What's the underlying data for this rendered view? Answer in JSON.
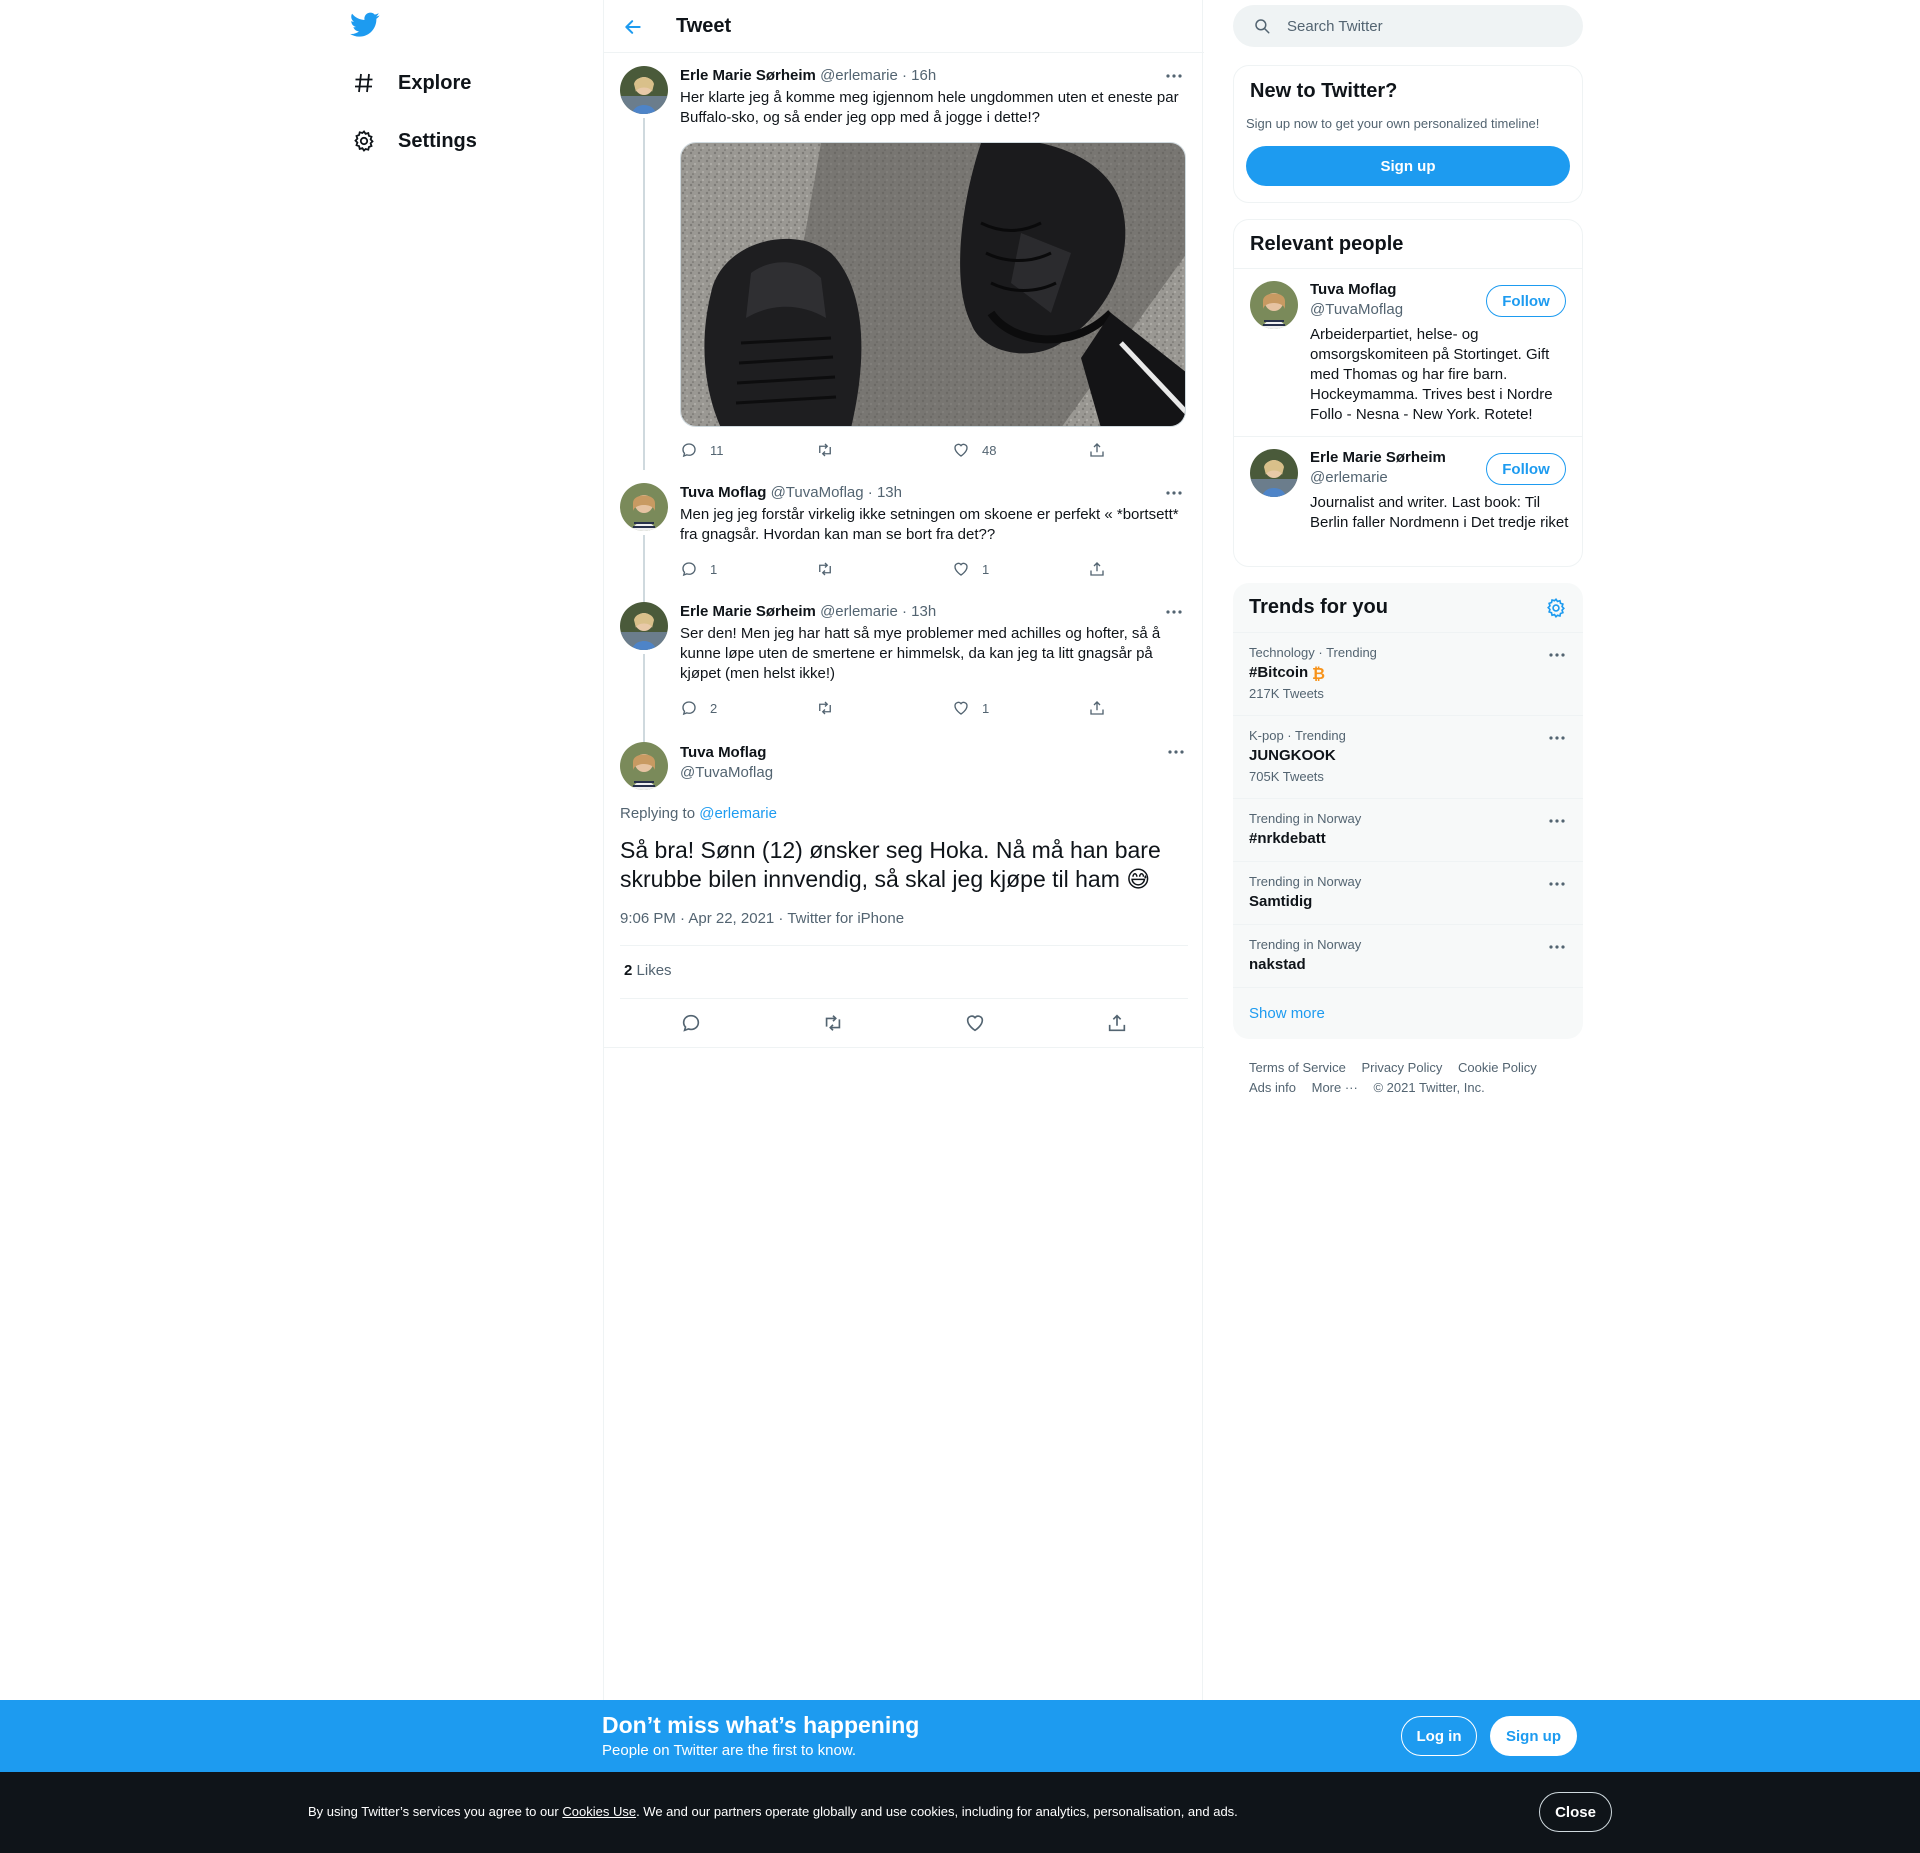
{
  "nav": {
    "logo": "twitter-bird-icon",
    "items": [
      {
        "label": "Explore",
        "icon": "hashtag-icon"
      },
      {
        "label": "Settings",
        "icon": "gear-icon"
      }
    ]
  },
  "header": {
    "title": "Tweet"
  },
  "thread": [
    {
      "name": "Erle Marie Sørheim",
      "handle": "@erlemarie",
      "time": "16h",
      "text": "Her klarte jeg å komme meg igjennom hele ungdommen uten et eneste par Buffalo-sko, og så ender jeg opp med å jogge i dette!?",
      "replies": "11",
      "retweets": "",
      "likes": "48"
    },
    {
      "name": "Tuva Moflag",
      "handle": "@TuvaMoflag",
      "time": "13h",
      "text": "Men jeg jeg forstår virkelig ikke setningen om skoene er perfekt « *bortsett* fra gnagsår. Hvordan kan man se bort fra det??",
      "replies": "1",
      "retweets": "",
      "likes": "1"
    },
    {
      "name": "Erle Marie Sørheim",
      "handle": "@erlemarie",
      "time": "13h",
      "text": "Ser den! Men jeg har hatt så mye problemer med achilles og hofter, så å kunne løpe uten de smertene er himmelsk, da kan jeg ta litt gnagsår på kjøpet (men helst ikke!)",
      "replies": "2",
      "retweets": "",
      "likes": "1"
    }
  ],
  "main_tweet": {
    "name": "Tuva Moflag",
    "handle": "@TuvaMoflag",
    "replying_prefix": "Replying to",
    "replying_to": "@erlemarie",
    "text": "Så bra! Sønn (12) ønsker seg Hoka. Nå må han bare skrubbe bilen innvendig, så skal jeg kjøpe til ham 😅",
    "timestamp": "9:06 PM · Apr 22, 2021 · Twitter for iPhone",
    "likes_count": "2",
    "likes_label": "Likes"
  },
  "sidebar": {
    "search_placeholder": "Search Twitter",
    "new_title": "New to Twitter?",
    "new_sub": "Sign up now to get your own personalized timeline!",
    "signup_label": "Sign up",
    "relevant_title": "Relevant people",
    "people": [
      {
        "name": "Tuva Moflag",
        "handle": "@TuvaMoflag",
        "bio": "Arbeiderpartiet, helse- og omsorgskomiteen på Stortinget. Gift med Thomas og har fire barn. Hockeymamma. Trives best i Nordre Follo - Nesna - New York. Rotete!",
        "follow": "Follow"
      },
      {
        "name": "Erle Marie Sørheim",
        "handle": "@erlemarie",
        "bio": "Journalist and writer. Last book: Til Berlin faller Nordmenn i Det tredje riket",
        "follow": "Follow"
      }
    ],
    "trends_title": "Trends for you",
    "trends": [
      {
        "context": "Technology · Trending",
        "name": "#Bitcoin",
        "count": "217K Tweets"
      },
      {
        "context": "K-pop · Trending",
        "name": "JUNGKOOK",
        "count": "705K Tweets"
      },
      {
        "context": "Trending in Norway",
        "name": "#nrkdebatt",
        "count": ""
      },
      {
        "context": "Trending in Norway",
        "name": "Samtidig",
        "count": ""
      },
      {
        "context": "Trending in Norway",
        "name": "nakstad",
        "count": ""
      }
    ],
    "show_more": "Show more",
    "footer": {
      "terms": "Terms of Service",
      "privacy": "Privacy Policy",
      "cookie": "Cookie Policy",
      "ads": "Ads info",
      "more": "More ···",
      "copyright": "© 2021 Twitter, Inc."
    }
  },
  "bottom_bar": {
    "title": "Don’t miss what’s happening",
    "subtitle": "People on Twitter are the first to know.",
    "login": "Log in",
    "signup": "Sign up"
  },
  "cookie": {
    "text_before": "By using Twitter’s services you agree to our ",
    "link": "Cookies Use",
    "text_after": ". We and our partners operate globally and use cookies, including for analytics, personalisation, and ads.",
    "close": "Close"
  },
  "colors": {
    "accent": "#1d9bf0",
    "text": "#0f1419",
    "secondary": "#536471",
    "border": "#eff3f4",
    "cookie_bg": "#0f1419"
  }
}
